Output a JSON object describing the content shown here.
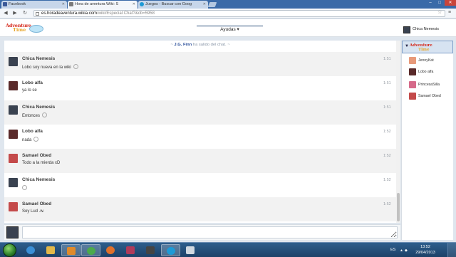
{
  "browser": {
    "tabs": [
      {
        "label": "Facebook",
        "icon": "facebook-icon",
        "color": "#3b5998"
      },
      {
        "label": "Hora de aventura Wiki: S",
        "icon": "wikia-icon",
        "color": "#7a7a7a"
      },
      {
        "label": "Juegos - Buscar con Goog",
        "icon": "skype-search-icon",
        "color": "#1e9ad6"
      }
    ],
    "url_host": "es.horadeaventura.wikia.com",
    "url_path": "/wiki/Especial:Chat?&cb=5958",
    "window_controls": [
      "–",
      "□",
      "✕"
    ]
  },
  "header": {
    "logo_line1": "Adventure",
    "logo_line2": "Time",
    "help_label": "Ayudas ▾",
    "current_user": "Chica Nemesis"
  },
  "chat": {
    "inline_alert_name": "J.G. Finn",
    "inline_alert_text": "ha salido del chat.",
    "messages": [
      {
        "user": "Chica Nemesis",
        "text": "Lobo soy nueva en la wiki",
        "time": "1:51",
        "emote": true,
        "avatar_color": "#3a4250"
      },
      {
        "user": "Lobo alfa",
        "text": "ya lo se",
        "time": "1:51",
        "emote": false,
        "avatar_color": "#5a2a2a"
      },
      {
        "user": "Chica Nemesis",
        "text": "Entonces",
        "time": "1:51",
        "emote": true,
        "avatar_color": "#3a4250"
      },
      {
        "user": "Lobo alfa",
        "text": "nada",
        "time": "1:52",
        "emote": true,
        "avatar_color": "#5a2a2a"
      },
      {
        "user": "Samael Obed",
        "text": "Todo a la mierda xD",
        "time": "1:52",
        "emote": false,
        "avatar_color": "#c44a4a"
      },
      {
        "user": "Chica Nemesis",
        "text": "",
        "time": "1:52",
        "emote": true,
        "avatar_color": "#3a4250"
      },
      {
        "user": "Samael Obed",
        "text": "Soy Lud .w.",
        "time": "1:52",
        "emote": false,
        "avatar_color": "#c44a4a"
      }
    ],
    "input_placeholder": ""
  },
  "rail": {
    "users": [
      {
        "name": "JennyKat",
        "avatar_color": "#e89a7a"
      },
      {
        "name": "Lobo alfa",
        "avatar_color": "#5a2a2a"
      },
      {
        "name": "PrincesaSilla",
        "avatar_color": "#d66a8a"
      },
      {
        "name": "Samael Obed",
        "avatar_color": "#c44a4a"
      }
    ]
  },
  "taskbar": {
    "apps": [
      {
        "name": "ie-icon",
        "color": "#3b8fd6"
      },
      {
        "name": "explorer-icon",
        "color": "#e2b84a"
      },
      {
        "name": "media-player-icon",
        "color": "#e08a2a"
      },
      {
        "name": "chrome-icon",
        "color": "#4caa4c"
      },
      {
        "name": "firefox-icon",
        "color": "#e0702a"
      },
      {
        "name": "winrar-icon",
        "color": "#b03a5a"
      },
      {
        "name": "game-icon",
        "color": "#444444"
      },
      {
        "name": "skype-icon",
        "color": "#1e9ad6"
      },
      {
        "name": "files-icon",
        "color": "#d0d8e0"
      }
    ],
    "language": "ES",
    "time": "13:52",
    "date": "29/04/2013"
  },
  "colors": {
    "accent": "#2b4f9a",
    "chrome_tab_bar": "#3a6aa8",
    "logo_red": "#d52b1e",
    "logo_yellow": "#e7a52a"
  }
}
